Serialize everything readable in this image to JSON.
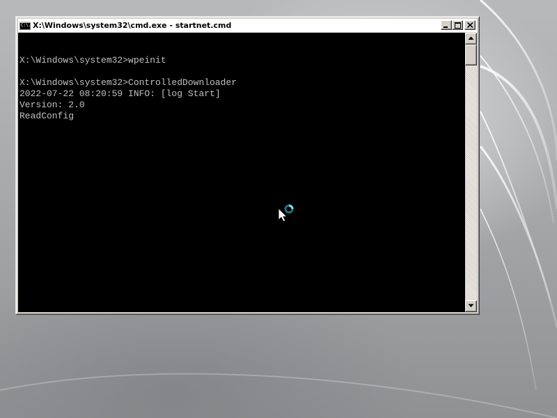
{
  "window": {
    "title": "X:\\Windows\\system32\\cmd.exe - startnet.cmd",
    "icon": "console-app-icon",
    "icon_text": "C:\\."
  },
  "console": {
    "lines": [
      "",
      "X:\\Windows\\system32>wpeinit",
      "",
      "X:\\Windows\\system32>ControlledDownloader",
      "2022-07-22 08:20:59 INFO: [log Start]",
      "Version: 2.0",
      "ReadConfig"
    ]
  },
  "colors": {
    "console_bg": "#000000",
    "console_text": "#c0c0c0",
    "title_bar_bg": "#ffffff",
    "window_frame": "#d4d0c8",
    "busy_ring": "#5fd3e0"
  },
  "cursor": {
    "state": "busy",
    "icon": "busy-pointer-icon"
  }
}
